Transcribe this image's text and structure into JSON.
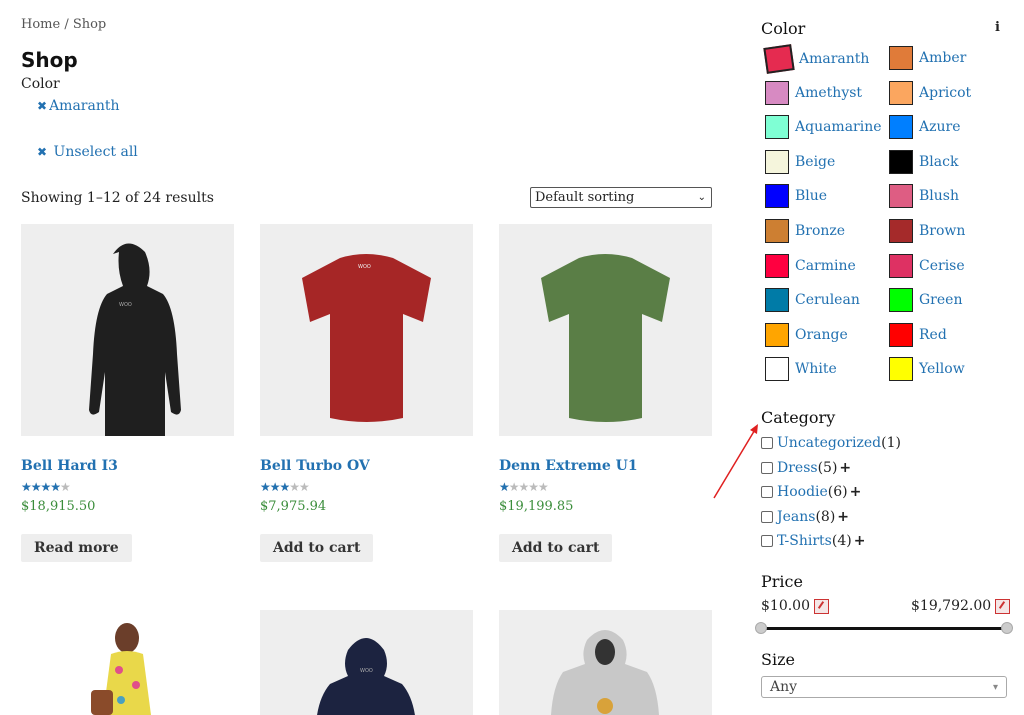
{
  "breadcrumb": "Home / Shop",
  "title": "Shop",
  "active_filter": {
    "label": "Color",
    "value": "Amaranth",
    "unselect": "Unselect all"
  },
  "result_count": "Showing 1–12 of 24 results",
  "sorting": {
    "selected": "Default sorting"
  },
  "products": [
    {
      "name": "Bell Hard I3",
      "rating": 4,
      "price": "$18,915.50",
      "button": "Read more",
      "image": "black-hoodie-back"
    },
    {
      "name": "Bell Turbo OV",
      "rating": 3,
      "price": "$7,975.94",
      "button": "Add to cart",
      "image": "red-tshirt-back"
    },
    {
      "name": "Denn Extreme U1",
      "rating": 1,
      "price": "$19,199.85",
      "button": "Add to cart",
      "image": "green-tshirt-back"
    },
    {
      "image": "woman-floral-dress"
    },
    {
      "image": "navy-hoodie-back"
    },
    {
      "image": "grey-hoodie-front"
    }
  ],
  "sidebar": {
    "color_title": "Color",
    "info_icon": "i",
    "colors": [
      {
        "name": "Amaranth",
        "hex": "#e52b50"
      },
      {
        "name": "Amber",
        "hex": "#e07b39"
      },
      {
        "name": "Amethyst",
        "hex": "#d78ac2"
      },
      {
        "name": "Apricot",
        "hex": "#fba65f"
      },
      {
        "name": "Aquamarine",
        "hex": "#7fffd4"
      },
      {
        "name": "Azure",
        "hex": "#007fff"
      },
      {
        "name": "Beige",
        "hex": "#f5f5dc"
      },
      {
        "name": "Black",
        "hex": "#000000"
      },
      {
        "name": "Blue",
        "hex": "#0000ff"
      },
      {
        "name": "Blush",
        "hex": "#de5d83"
      },
      {
        "name": "Bronze",
        "hex": "#cd7f32"
      },
      {
        "name": "Brown",
        "hex": "#a52a2a"
      },
      {
        "name": "Carmine",
        "hex": "#ff0040"
      },
      {
        "name": "Cerise",
        "hex": "#de3163"
      },
      {
        "name": "Cerulean",
        "hex": "#007ba7"
      },
      {
        "name": "Green",
        "hex": "#00ff00"
      },
      {
        "name": "Orange",
        "hex": "#ffa500"
      },
      {
        "name": "Red",
        "hex": "#ff0000"
      },
      {
        "name": "White",
        "hex": "#ffffff"
      },
      {
        "name": "Yellow",
        "hex": "#ffff00"
      }
    ],
    "category_title": "Category",
    "categories": [
      {
        "name": "Uncategorized",
        "count": "(1)",
        "expand": ""
      },
      {
        "name": "Dress",
        "count": "(5)",
        "expand": "+"
      },
      {
        "name": "Hoodie",
        "count": "(6)",
        "expand": "+"
      },
      {
        "name": "Jeans",
        "count": "(8)",
        "expand": "+"
      },
      {
        "name": "T-Shirts",
        "count": "(4)",
        "expand": "+"
      }
    ],
    "price_title": "Price",
    "price_min": "$10.00",
    "price_max": "$19,792.00",
    "size_title": "Size",
    "size_selected": "Any"
  }
}
